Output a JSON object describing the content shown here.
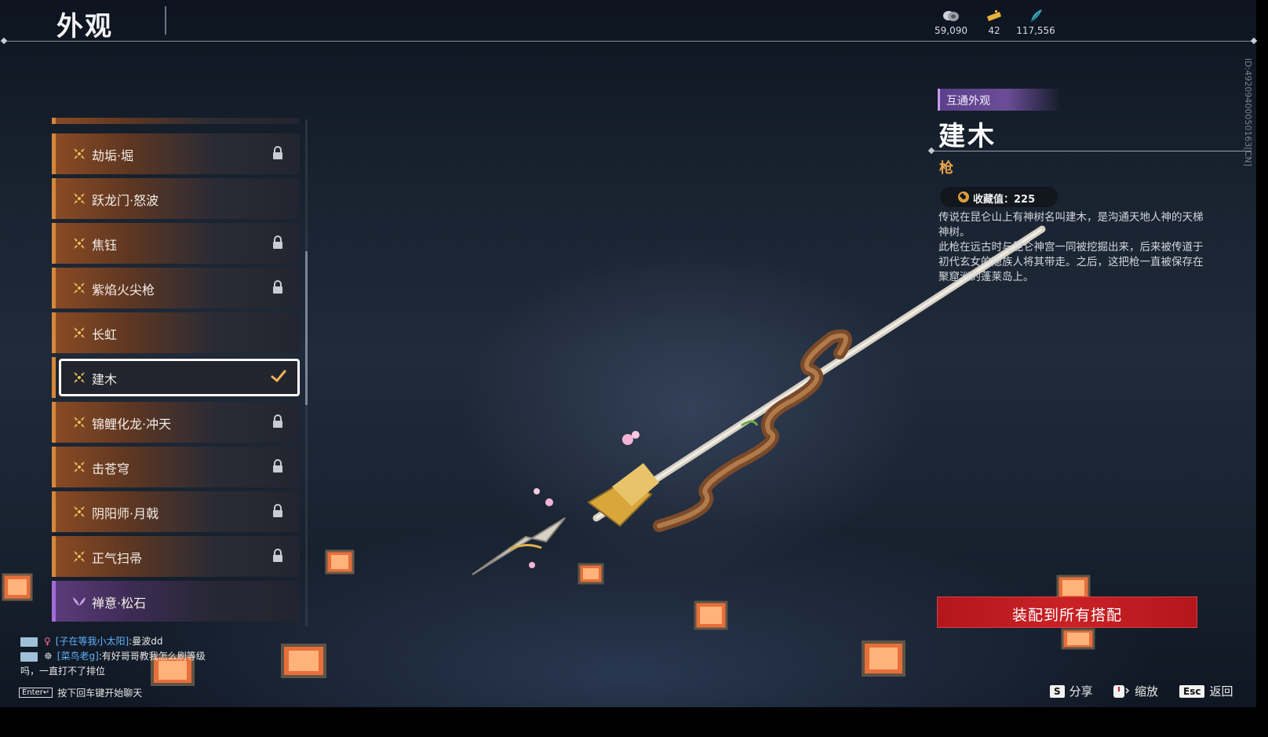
{
  "header": {
    "title": "外观",
    "currencies": [
      {
        "icon": "coin-icon",
        "value": "59,090"
      },
      {
        "icon": "ticket-icon",
        "value": "42"
      },
      {
        "icon": "feather-icon",
        "value": "117,556"
      }
    ],
    "player_id": "ID:4920940005016​3[CN]"
  },
  "list": {
    "items": [
      {
        "label": "劫垢·堀",
        "locked": true,
        "selected": false,
        "icon": "flower-icon"
      },
      {
        "label": "跃龙门·怒波",
        "locked": false,
        "selected": false,
        "icon": "flower-icon"
      },
      {
        "label": "焦钰",
        "locked": true,
        "selected": false,
        "icon": "flower-icon"
      },
      {
        "label": "紫焰火尖枪",
        "locked": true,
        "selected": false,
        "icon": "flower-icon"
      },
      {
        "label": "长虹",
        "locked": false,
        "selected": false,
        "icon": "flower-icon"
      },
      {
        "label": "建木",
        "locked": false,
        "selected": true,
        "icon": "flower-icon"
      },
      {
        "label": "锦鲤化龙·冲天",
        "locked": true,
        "selected": false,
        "icon": "flower-icon"
      },
      {
        "label": "击苍穹",
        "locked": true,
        "selected": false,
        "icon": "flower-icon"
      },
      {
        "label": "阴阳师·月戟",
        "locked": true,
        "selected": false,
        "icon": "flower-icon"
      },
      {
        "label": "正气扫帚",
        "locked": true,
        "selected": false,
        "icon": "flower-icon"
      },
      {
        "label": "禅意·松石",
        "locked": false,
        "selected": false,
        "icon": "lotus-icon"
      }
    ]
  },
  "detail": {
    "tag": "互通外观",
    "name": "建木",
    "type": "枪",
    "collect_label": "收藏值：225",
    "desc1": "传说在昆仑山上有神树名叫建木，是沟通天地人神的天梯神树。",
    "desc2": "此枪在远古时与昆仑神宫一同被挖掘出来，后来被传道于初代玄女的隐族人将其带走。之后，这把枪一直被保存在聚窟洲的蓬莱岛上。",
    "equip_button": "装配到所有搭配"
  },
  "hints": [
    {
      "key": "S",
      "label": "分享"
    },
    {
      "key": "",
      "label": "缩放"
    },
    {
      "key": "Esc",
      "label": "返回"
    }
  ],
  "chat": {
    "lines": [
      {
        "name": "[子在等我小太阳]",
        "msg": ":曼波dd"
      },
      {
        "name": "[菜鸟老g]",
        "msg": ":有好哥哥教我怎么刷等级"
      },
      {
        "name": "",
        "msg": "吗，一直打不了排位"
      }
    ],
    "enter_key": "Enter↵",
    "enter_hint": "按下回车键开始聊天"
  },
  "colors": {
    "accent_orange": "#d5873a",
    "tag_purple": "#6b4d97",
    "type_gold": "#e7a54a",
    "button_red": "#c92226"
  }
}
